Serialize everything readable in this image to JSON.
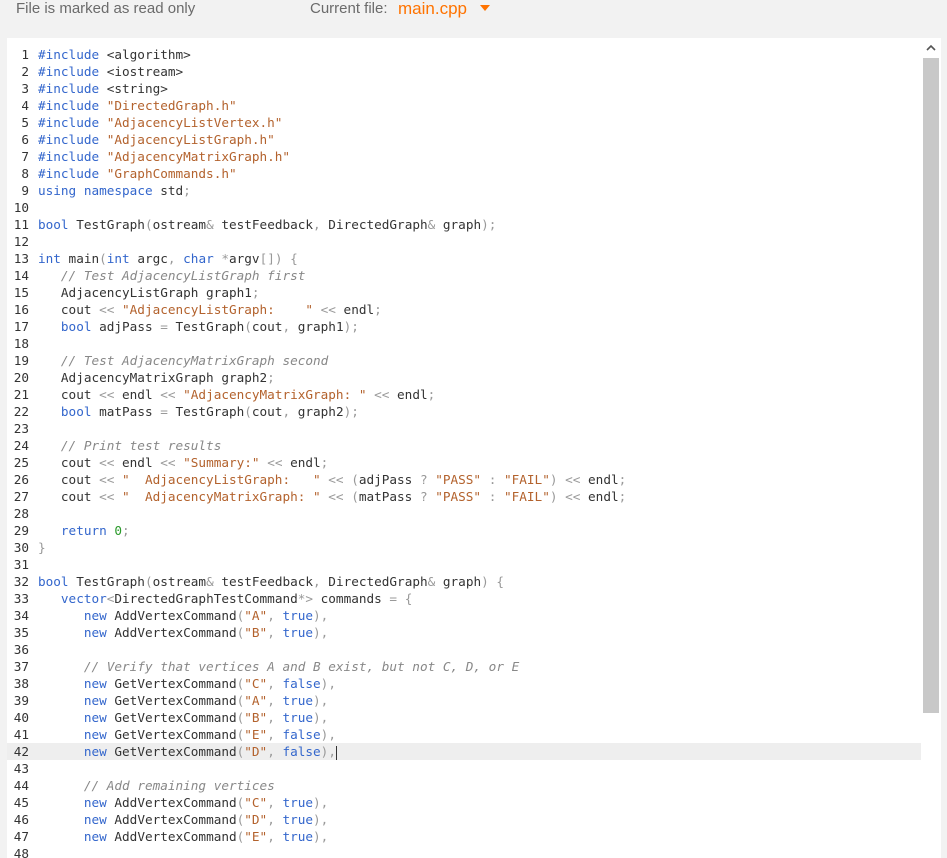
{
  "header": {
    "readonly_notice": "File is marked as read only",
    "file_label": "Current file:",
    "file_name": "main.cpp"
  },
  "editor": {
    "active_line": 42,
    "lines": [
      "#include <algorithm>",
      "#include <iostream>",
      "#include <string>",
      "#include \"DirectedGraph.h\"",
      "#include \"AdjacencyListVertex.h\"",
      "#include \"AdjacencyListGraph.h\"",
      "#include \"AdjacencyMatrixGraph.h\"",
      "#include \"GraphCommands.h\"",
      "using namespace std;",
      "",
      "bool TestGraph(ostream& testFeedback, DirectedGraph& graph);",
      "",
      "int main(int argc, char *argv[]) {",
      "   // Test AdjacencyListGraph first",
      "   AdjacencyListGraph graph1;",
      "   cout << \"AdjacencyListGraph:    \" << endl;",
      "   bool adjPass = TestGraph(cout, graph1);",
      "",
      "   // Test AdjacencyMatrixGraph second",
      "   AdjacencyMatrixGraph graph2;",
      "   cout << endl << \"AdjacencyMatrixGraph: \" << endl;",
      "   bool matPass = TestGraph(cout, graph2);",
      "",
      "   // Print test results",
      "   cout << endl << \"Summary:\" << endl;",
      "   cout << \"  AdjacencyListGraph:   \" << (adjPass ? \"PASS\" : \"FAIL\") << endl;",
      "   cout << \"  AdjacencyMatrixGraph: \" << (matPass ? \"PASS\" : \"FAIL\") << endl;",
      "",
      "   return 0;",
      "}",
      "",
      "bool TestGraph(ostream& testFeedback, DirectedGraph& graph) {",
      "   vector<DirectedGraphTestCommand*> commands = {",
      "      new AddVertexCommand(\"A\", true),",
      "      new AddVertexCommand(\"B\", true),",
      "",
      "      // Verify that vertices A and B exist, but not C, D, or E",
      "      new GetVertexCommand(\"C\", false),",
      "      new GetVertexCommand(\"A\", true),",
      "      new GetVertexCommand(\"B\", true),",
      "      new GetVertexCommand(\"E\", false),",
      "      new GetVertexCommand(\"D\", false),",
      "",
      "      // Add remaining vertices",
      "      new AddVertexCommand(\"C\", true),",
      "      new AddVertexCommand(\"D\", true),",
      "      new AddVertexCommand(\"E\", true),",
      ""
    ]
  },
  "icons": {
    "file_dropdown": "caret-down-icon",
    "scroll_up": "chevron-up-icon"
  },
  "colors": {
    "accent": "#ff7300",
    "keyword": "#3366cc",
    "string": "#b3622d",
    "comment": "#888888",
    "number": "#2a9a2a"
  }
}
